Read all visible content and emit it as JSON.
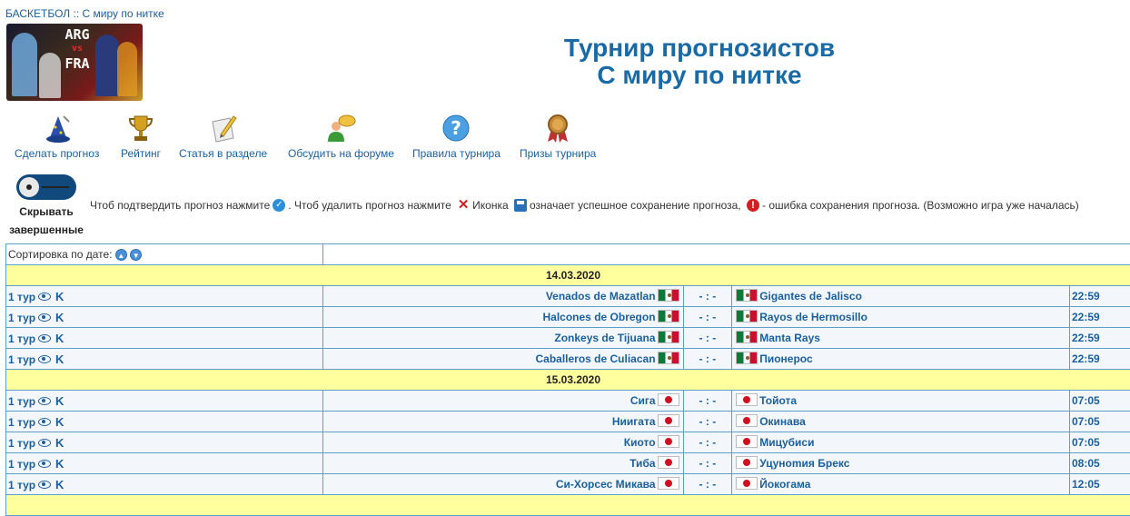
{
  "breadcrumb": "БАСКЕТБОЛ :: С миру по нитке",
  "banner": {
    "top": "ARG",
    "vs": "vs",
    "bottom": "FRA"
  },
  "title": {
    "line1": "Турнир прогнозистов",
    "line2": "С миру по нитке"
  },
  "nav": [
    {
      "label": "Сделать прогноз",
      "icon": "wizard-hat-icon"
    },
    {
      "label": "Рейтинг",
      "icon": "trophy-icon"
    },
    {
      "label": "Статья в разделе",
      "icon": "pencil-paper-icon"
    },
    {
      "label": "Обсудить на форуме",
      "icon": "forum-chat-icon"
    },
    {
      "label": "Правила турнира",
      "icon": "help-question-icon"
    },
    {
      "label": "Призы турнира",
      "icon": "medal-icon"
    }
  ],
  "hide_toggle": {
    "label": "Скрывать завершенные",
    "state": "off"
  },
  "info": {
    "t1": "Чтоб подтвердить прогноз нажмите",
    "t2": ". Чтоб удалить прогноз нажмите",
    "t3": "Иконка",
    "t4": "означает успешное сохранение прогноза,",
    "t5": "- ошибка сохранения прогноза. (Возможно игра уже началась)"
  },
  "sort_label": "Сортировка по дате:",
  "colors": {
    "accent": "#1a5f9e",
    "title": "#1a6aa5",
    "date_bg": "#ffff9d",
    "border": "#5aa0c8"
  },
  "days": [
    {
      "date": "14.03.2020",
      "matches": [
        {
          "tour": "1 тур",
          "k": "K",
          "home": "Venados de Mazatlan",
          "home_flag": "mex",
          "score": "- : -",
          "away": "Gigantes de Jalisco",
          "away_flag": "mex",
          "time": "22:59"
        },
        {
          "tour": "1 тур",
          "k": "K",
          "home": "Halcones de Obregon",
          "home_flag": "mex",
          "score": "- : -",
          "away": "Rayos de Hermosillo",
          "away_flag": "mex",
          "time": "22:59"
        },
        {
          "tour": "1 тур",
          "k": "K",
          "home": "Zonkeys de Tijuana",
          "home_flag": "mex",
          "score": "- : -",
          "away": "Manta Rays",
          "away_flag": "mex",
          "time": "22:59"
        },
        {
          "tour": "1 тур",
          "k": "K",
          "home": "Caballeros de Culiacan",
          "home_flag": "mex",
          "score": "- : -",
          "away": "Пионерос",
          "away_flag": "mex",
          "time": "22:59"
        }
      ]
    },
    {
      "date": "15.03.2020",
      "matches": [
        {
          "tour": "1 тур",
          "k": "K",
          "home": "Сига",
          "home_flag": "jpn",
          "score": "- : -",
          "away": "Тойота",
          "away_flag": "jpn",
          "time": "07:05"
        },
        {
          "tour": "1 тур",
          "k": "K",
          "home": "Ниигата",
          "home_flag": "jpn",
          "score": "- : -",
          "away": "Окинава",
          "away_flag": "jpn",
          "time": "07:05"
        },
        {
          "tour": "1 тур",
          "k": "K",
          "home": "Киото",
          "home_flag": "jpn",
          "score": "- : -",
          "away": "Мицубиси",
          "away_flag": "jpn",
          "time": "07:05"
        },
        {
          "tour": "1 тур",
          "k": "K",
          "home": "Тиба",
          "home_flag": "jpn",
          "score": "- : -",
          "away": "Уцунomия Брекс",
          "away_flag": "jpn",
          "time": "08:05"
        },
        {
          "tour": "1 тур",
          "k": "K",
          "home": "Си-Хорсес Микава",
          "home_flag": "jpn",
          "score": "- : -",
          "away": "Йокогама",
          "away_flag": "jpn",
          "time": "12:05"
        }
      ]
    }
  ]
}
